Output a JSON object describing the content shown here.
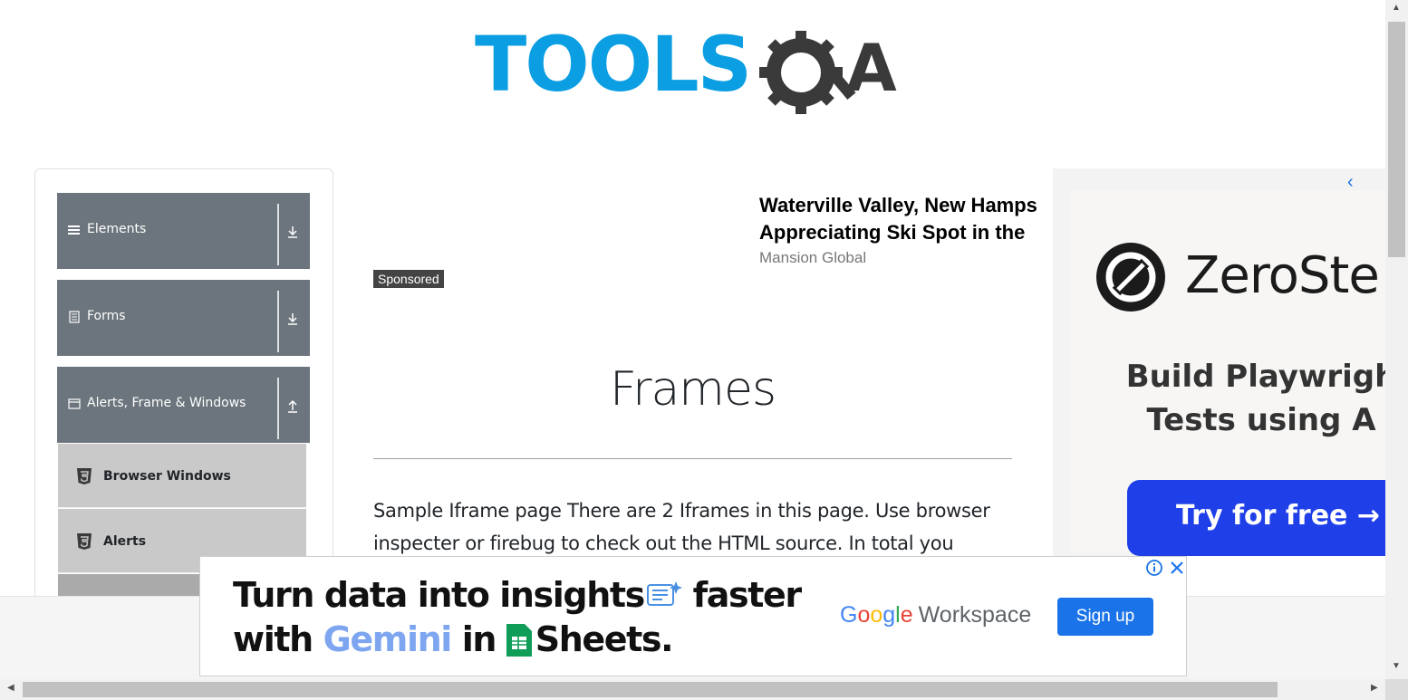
{
  "header": {
    "logo_text": "TOOLSQA",
    "logo_colors": {
      "tools": "#0b9ee3",
      "qa": "#3a3a3a"
    }
  },
  "sidebar": {
    "groups": [
      {
        "label": "Elements",
        "icon": "hamburger-icon",
        "arrow": "download-arrow-icon"
      },
      {
        "label": "Forms",
        "icon": "document-icon",
        "arrow": "download-arrow-icon"
      },
      {
        "label": "Alerts, Frame & Windows",
        "icon": "window-icon",
        "arrow": "upload-arrow-icon"
      }
    ],
    "items": [
      {
        "label": "Browser Windows",
        "icon": "html5-icon"
      },
      {
        "label": "Alerts",
        "icon": "html5-icon"
      }
    ]
  },
  "sponsored_ad": {
    "title_line1": "Waterville Valley, New Hamps",
    "title_line2": "Appreciating Ski Spot in the",
    "source": "Mansion Global",
    "badge": "Sponsored"
  },
  "main": {
    "title": "Frames",
    "body_line1": "Sample Iframe page There are 2 Iframes in this page. Use browser",
    "body_line2": "inspecter or firebug to check out the HTML source. In total you"
  },
  "right_ad": {
    "brand": "ZeroSte",
    "tagline_line1": "Build Playwrigh",
    "tagline_line2": "Tests using A",
    "cta": "Try for free →"
  },
  "banner_ad": {
    "line1_a": "Turn data into insights",
    "line1_b": " faster",
    "line2_a": "with ",
    "line2_gemini": "Gemini",
    "line2_b": " in ",
    "line2_c": "Sheets.",
    "google": [
      "G",
      "o",
      "o",
      "g",
      "l",
      "e"
    ],
    "workspace": "Workspace",
    "signup": "Sign up"
  },
  "colors": {
    "sidebar_group": "#6c757d",
    "sidebar_item": "#c9c9c9",
    "cta_blue": "#1f3fe8",
    "signup_blue": "#1a73e8"
  }
}
